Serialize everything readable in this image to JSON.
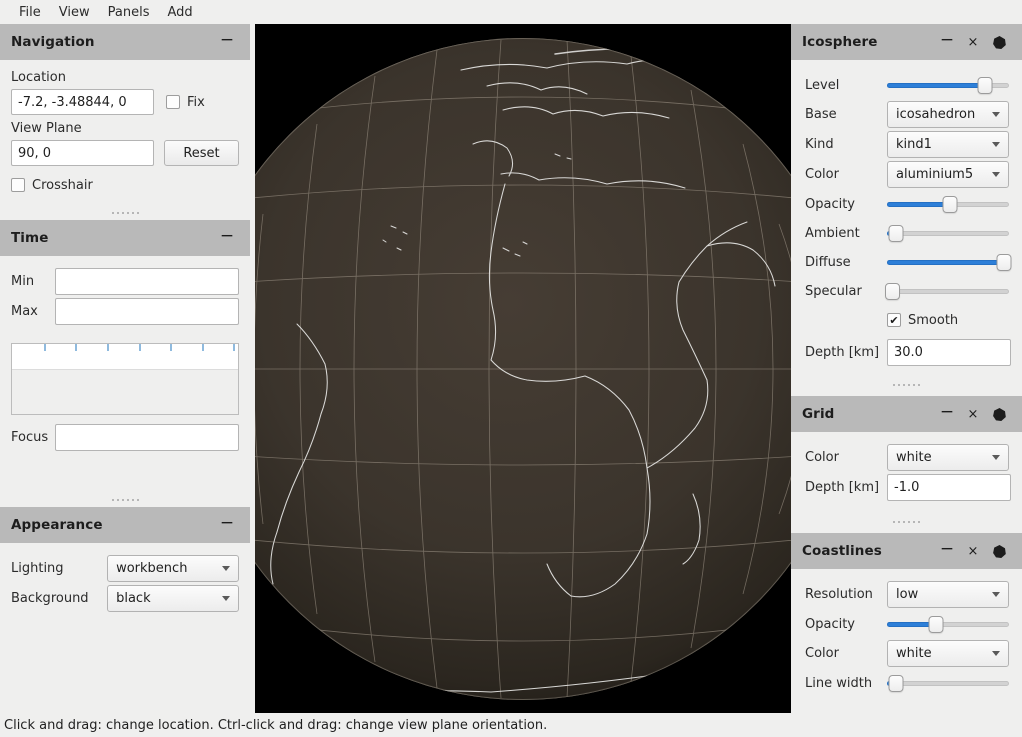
{
  "menubar": {
    "items": [
      {
        "label": "File"
      },
      {
        "label": "View"
      },
      {
        "label": "Panels"
      },
      {
        "label": "Add"
      }
    ]
  },
  "panel_controls": {
    "minimize": "−",
    "close": "×",
    "shape_icon": "heptagon-icon"
  },
  "left_dock": {
    "navigation": {
      "title": "Navigation",
      "location_label": "Location",
      "location_value": "-7.2, -3.48844, 0",
      "fix_label": "Fix",
      "fix_checked": false,
      "view_plane_label": "View Plane",
      "view_plane_value": "90, 0",
      "reset_label": "Reset",
      "crosshair_label": "Crosshair",
      "crosshair_checked": false
    },
    "time": {
      "title": "Time",
      "min_label": "Min",
      "min_value": "",
      "max_label": "Max",
      "max_value": "",
      "focus_label": "Focus",
      "focus_value": "",
      "timeline_ticks": [
        14,
        28,
        42,
        56,
        70,
        84,
        98
      ]
    },
    "appearance": {
      "title": "Appearance",
      "lighting_label": "Lighting",
      "lighting_value": "workbench",
      "background_label": "Background",
      "background_value": "black"
    }
  },
  "right_dock": {
    "icosphere": {
      "title": "Icosphere",
      "level_label": "Level",
      "level_value": 80,
      "base_label": "Base",
      "base_value": "icosahedron",
      "kind_label": "Kind",
      "kind_value": "kind1",
      "color_label": "Color",
      "color_value": "aluminium5",
      "opacity_label": "Opacity",
      "opacity_value": 52,
      "ambient_label": "Ambient",
      "ambient_value": 7,
      "diffuse_label": "Diffuse",
      "diffuse_value": 96,
      "specular_label": "Specular",
      "specular_value": 0,
      "smooth_label": "Smooth",
      "smooth_checked": true,
      "depth_label": "Depth [km]",
      "depth_value": "30.0"
    },
    "grid": {
      "title": "Grid",
      "color_label": "Color",
      "color_value": "white",
      "depth_label": "Depth [km]",
      "depth_value": "-1.0"
    },
    "coastlines": {
      "title": "Coastlines",
      "resolution_label": "Resolution",
      "resolution_value": "low",
      "opacity_label": "Opacity",
      "opacity_value": 40,
      "color_label": "Color",
      "color_value": "white",
      "line_width_label": "Line width",
      "line_width_value": 7
    }
  },
  "statusbar": {
    "text": "Click and drag: change location. Ctrl-click and drag: change view plane orientation."
  },
  "colors": {
    "accent": "#2d7fd8",
    "panel_header": "#b9b9b9",
    "panel_bg": "#efefee",
    "viewport_bg": "#000000",
    "globe_surface": "#3a332c",
    "grid_line": "#9c9285",
    "coastline": "#f2f2f2"
  }
}
